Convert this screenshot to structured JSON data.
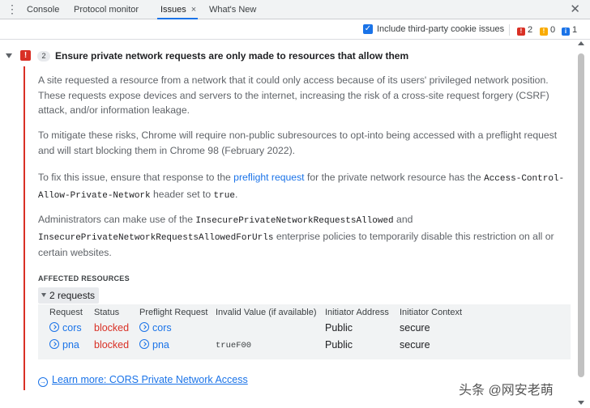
{
  "tabs": {
    "items": [
      "Console",
      "Protocol monitor",
      "Issues",
      "What's New"
    ],
    "active_close": "×",
    "menu": "⋮",
    "panel_close": "✕"
  },
  "toolbar": {
    "checkbox_checked": true,
    "checkbox_label": "Include third-party cookie issues",
    "counts": {
      "errors": "2",
      "warnings": "0",
      "info": "1"
    }
  },
  "issue": {
    "count": "2",
    "title": "Ensure private network requests are only made to resources that allow them",
    "p1": "A site requested a resource from a network that it could only access because of its users' privileged network position. These requests expose devices and servers to the internet, increasing the risk of a cross-site request forgery (CSRF) attack, and/or information leakage.",
    "p2": "To mitigate these risks, Chrome will require non-public subresources to opt-into being accessed with a preflight request and will start blocking them in Chrome 98 (February 2022).",
    "p3_pre": "To fix this issue, ensure that response to the ",
    "p3_link": "preflight request",
    "p3_mid": " for the private network resource has the ",
    "p3_code1": "Access-Control-Allow-Private-Network",
    "p3_mid2": " header set to ",
    "p3_code2": "true",
    "p3_end": ".",
    "p4_pre": "Administrators can make use of the ",
    "p4_code1": "InsecurePrivateNetworkRequestsAllowed",
    "p4_mid": " and ",
    "p4_code2": "InsecurePrivateNetworkRequestsAllowedForUrls",
    "p4_end": " enterprise policies to temporarily disable this restriction on all or certain websites.",
    "affected_label": "AFFECTED RESOURCES",
    "requests_toggle": "2 requests",
    "columns": [
      "Request",
      "Status",
      "Preflight Request",
      "Invalid Value (if available)",
      "Initiator Address",
      "Initiator Context"
    ],
    "rows": [
      {
        "request": "cors",
        "status": "blocked",
        "preflight": "cors",
        "invalid": "",
        "address": "Public",
        "context": "secure"
      },
      {
        "request": "pna",
        "status": "blocked",
        "preflight": "pna",
        "invalid": "trueF00",
        "address": "Public",
        "context": "secure"
      }
    ],
    "learn_more": "Learn more: CORS Private Network Access"
  },
  "watermark": "头条 @网安老萌",
  "colors": {
    "error": "#d93025",
    "link": "#1a73e8",
    "warning": "#f9ab00"
  }
}
